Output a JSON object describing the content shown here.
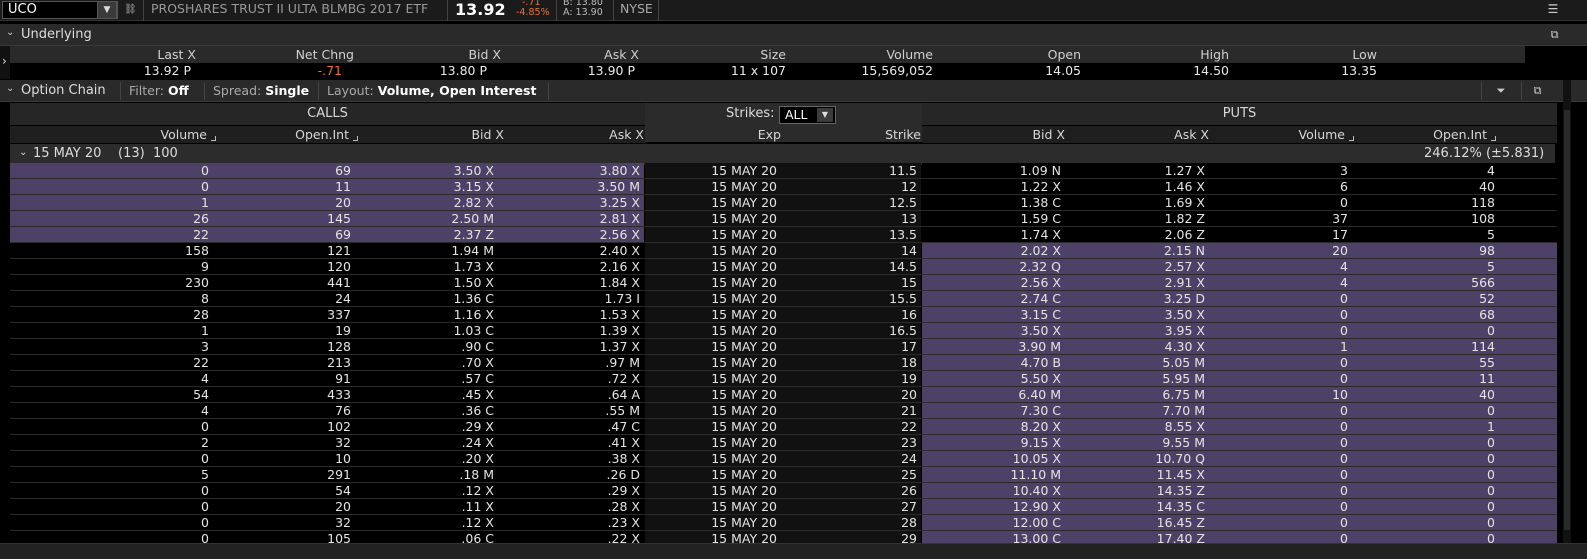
{
  "quote": {
    "symbol": "UCO",
    "description": "PROSHARES TRUST II ULTA BLMBG 2017 ETF",
    "last": "13.92",
    "net_change": "-.71",
    "pct_change": "-4.85%",
    "bid": "B: 13.80",
    "ask": "A: 13.90",
    "exchange": "NYSE"
  },
  "underlying": {
    "title": "Underlying",
    "headers": [
      "Last X",
      "Net Chng",
      "Bid X",
      "Ask X",
      "Size",
      "Volume",
      "Open",
      "High",
      "Low"
    ],
    "values": [
      "13.92 P",
      "-.71",
      "13.80 P",
      "13.90 P",
      "11 x 107",
      "15,569,052",
      "14.05",
      "14.50",
      "13.35"
    ],
    "negative_index": 1
  },
  "option_chain": {
    "title": "Option Chain",
    "filter_label": "Filter:",
    "filter_value": "Off",
    "spread_label": "Spread:",
    "spread_value": "Single",
    "layout_label": "Layout:",
    "layout_value": "Volume, Open Interest",
    "calls_label": "CALLS",
    "puts_label": "PUTS",
    "strikes_label": "Strikes:",
    "strikes_value": "ALL",
    "headers": {
      "call_volume": "Volume",
      "call_oi": "Open.Int",
      "call_bid": "Bid X",
      "call_ask": "Ask X",
      "exp": "Exp",
      "strike": "Strike",
      "put_bid": "Bid X",
      "put_ask": "Ask X",
      "put_volume": "Volume",
      "put_oi": "Open.Int"
    },
    "expiration": {
      "label": "15 MAY 20",
      "days": "(13)",
      "multiplier": "100",
      "iv": "246.12% (±5.831)"
    },
    "rows": [
      {
        "cv": "0",
        "coi": "69",
        "cb": "3.50 X",
        "ca": "3.80 X",
        "exp": "15 MAY 20",
        "k": "11.5",
        "pb": "1.09 N",
        "pa": "1.27 X",
        "pv": "3",
        "poi": "4",
        "call_itm": true
      },
      {
        "cv": "0",
        "coi": "11",
        "cb": "3.15 X",
        "ca": "3.50 M",
        "exp": "15 MAY 20",
        "k": "12",
        "pb": "1.22 X",
        "pa": "1.46 X",
        "pv": "6",
        "poi": "40",
        "call_itm": true
      },
      {
        "cv": "1",
        "coi": "20",
        "cb": "2.82 X",
        "ca": "3.25 X",
        "exp": "15 MAY 20",
        "k": "12.5",
        "pb": "1.38 C",
        "pa": "1.69 X",
        "pv": "0",
        "poi": "118",
        "call_itm": true
      },
      {
        "cv": "26",
        "coi": "145",
        "cb": "2.50 M",
        "ca": "2.81 X",
        "exp": "15 MAY 20",
        "k": "13",
        "pb": "1.59 C",
        "pa": "1.82 Z",
        "pv": "37",
        "poi": "108",
        "call_itm": true
      },
      {
        "cv": "22",
        "coi": "69",
        "cb": "2.37 Z",
        "ca": "2.56 X",
        "exp": "15 MAY 20",
        "k": "13.5",
        "pb": "1.74 X",
        "pa": "2.06 Z",
        "pv": "17",
        "poi": "5",
        "call_itm": true
      },
      {
        "cv": "158",
        "coi": "121",
        "cb": "1.94 M",
        "ca": "2.40 X",
        "exp": "15 MAY 20",
        "k": "14",
        "pb": "2.02 X",
        "pa": "2.15 N",
        "pv": "20",
        "poi": "98",
        "call_itm": false
      },
      {
        "cv": "9",
        "coi": "120",
        "cb": "1.73 X",
        "ca": "2.16 X",
        "exp": "15 MAY 20",
        "k": "14.5",
        "pb": "2.32 Q",
        "pa": "2.57 X",
        "pv": "4",
        "poi": "5",
        "call_itm": false
      },
      {
        "cv": "230",
        "coi": "441",
        "cb": "1.50 X",
        "ca": "1.84 X",
        "exp": "15 MAY 20",
        "k": "15",
        "pb": "2.56 X",
        "pa": "2.91 X",
        "pv": "4",
        "poi": "566",
        "call_itm": false
      },
      {
        "cv": "8",
        "coi": "24",
        "cb": "1.36 C",
        "ca": "1.73 I",
        "exp": "15 MAY 20",
        "k": "15.5",
        "pb": "2.74 C",
        "pa": "3.25 D",
        "pv": "0",
        "poi": "52",
        "call_itm": false
      },
      {
        "cv": "28",
        "coi": "337",
        "cb": "1.16 X",
        "ca": "1.53 X",
        "exp": "15 MAY 20",
        "k": "16",
        "pb": "3.15 C",
        "pa": "3.50 X",
        "pv": "0",
        "poi": "68",
        "call_itm": false
      },
      {
        "cv": "1",
        "coi": "19",
        "cb": "1.03 C",
        "ca": "1.39 X",
        "exp": "15 MAY 20",
        "k": "16.5",
        "pb": "3.50 X",
        "pa": "3.95 X",
        "pv": "0",
        "poi": "0",
        "call_itm": false
      },
      {
        "cv": "3",
        "coi": "128",
        "cb": ".90 C",
        "ca": "1.37 X",
        "exp": "15 MAY 20",
        "k": "17",
        "pb": "3.90 M",
        "pa": "4.30 X",
        "pv": "1",
        "poi": "114",
        "call_itm": false
      },
      {
        "cv": "22",
        "coi": "213",
        "cb": ".70 X",
        "ca": ".97 M",
        "exp": "15 MAY 20",
        "k": "18",
        "pb": "4.70 B",
        "pa": "5.05 M",
        "pv": "0",
        "poi": "55",
        "call_itm": false
      },
      {
        "cv": "4",
        "coi": "91",
        "cb": ".57 C",
        "ca": ".72 X",
        "exp": "15 MAY 20",
        "k": "19",
        "pb": "5.50 X",
        "pa": "5.95 M",
        "pv": "0",
        "poi": "11",
        "call_itm": false
      },
      {
        "cv": "54",
        "coi": "433",
        "cb": ".45 X",
        "ca": ".64 A",
        "exp": "15 MAY 20",
        "k": "20",
        "pb": "6.40 M",
        "pa": "6.75 M",
        "pv": "10",
        "poi": "40",
        "call_itm": false
      },
      {
        "cv": "4",
        "coi": "76",
        "cb": ".36 C",
        "ca": ".55 M",
        "exp": "15 MAY 20",
        "k": "21",
        "pb": "7.30 C",
        "pa": "7.70 M",
        "pv": "0",
        "poi": "0",
        "call_itm": false
      },
      {
        "cv": "0",
        "coi": "102",
        "cb": ".29 X",
        "ca": ".47 C",
        "exp": "15 MAY 20",
        "k": "22",
        "pb": "8.20 X",
        "pa": "8.55 X",
        "pv": "0",
        "poi": "1",
        "call_itm": false
      },
      {
        "cv": "2",
        "coi": "32",
        "cb": ".24 X",
        "ca": ".41 X",
        "exp": "15 MAY 20",
        "k": "23",
        "pb": "9.15 X",
        "pa": "9.55 M",
        "pv": "0",
        "poi": "0",
        "call_itm": false
      },
      {
        "cv": "0",
        "coi": "10",
        "cb": ".20 X",
        "ca": ".38 X",
        "exp": "15 MAY 20",
        "k": "24",
        "pb": "10.05 X",
        "pa": "10.70 Q",
        "pv": "0",
        "poi": "0",
        "call_itm": false
      },
      {
        "cv": "5",
        "coi": "291",
        "cb": ".18 M",
        "ca": ".26 D",
        "exp": "15 MAY 20",
        "k": "25",
        "pb": "11.10 M",
        "pa": "11.45 X",
        "pv": "0",
        "poi": "0",
        "call_itm": false
      },
      {
        "cv": "0",
        "coi": "54",
        "cb": ".12 X",
        "ca": ".29 X",
        "exp": "15 MAY 20",
        "k": "26",
        "pb": "10.40 X",
        "pa": "14.35 Z",
        "pv": "0",
        "poi": "0",
        "call_itm": false
      },
      {
        "cv": "0",
        "coi": "20",
        "cb": ".11 X",
        "ca": ".28 X",
        "exp": "15 MAY 20",
        "k": "27",
        "pb": "12.90 X",
        "pa": "14.35 C",
        "pv": "0",
        "poi": "0",
        "call_itm": false
      },
      {
        "cv": "0",
        "coi": "32",
        "cb": ".12 X",
        "ca": ".23 X",
        "exp": "15 MAY 20",
        "k": "28",
        "pb": "12.00 C",
        "pa": "16.45 Z",
        "pv": "0",
        "poi": "0",
        "call_itm": false
      },
      {
        "cv": "0",
        "coi": "105",
        "cb": ".06 C",
        "ca": ".22 X",
        "exp": "15 MAY 20",
        "k": "29",
        "pb": "13.00 C",
        "pa": "17.40 Z",
        "pv": "0",
        "poi": "0",
        "call_itm": false
      }
    ]
  },
  "colors": {
    "itm": "#4e4168",
    "otm": "#000000",
    "negative": "#e6713b",
    "header_bg": "#2a2a2a"
  },
  "icons": [
    "chevron-down-icon",
    "link-icon",
    "menu-icon",
    "popout-icon",
    "funnel-icon",
    "chevron-right-icon"
  ]
}
